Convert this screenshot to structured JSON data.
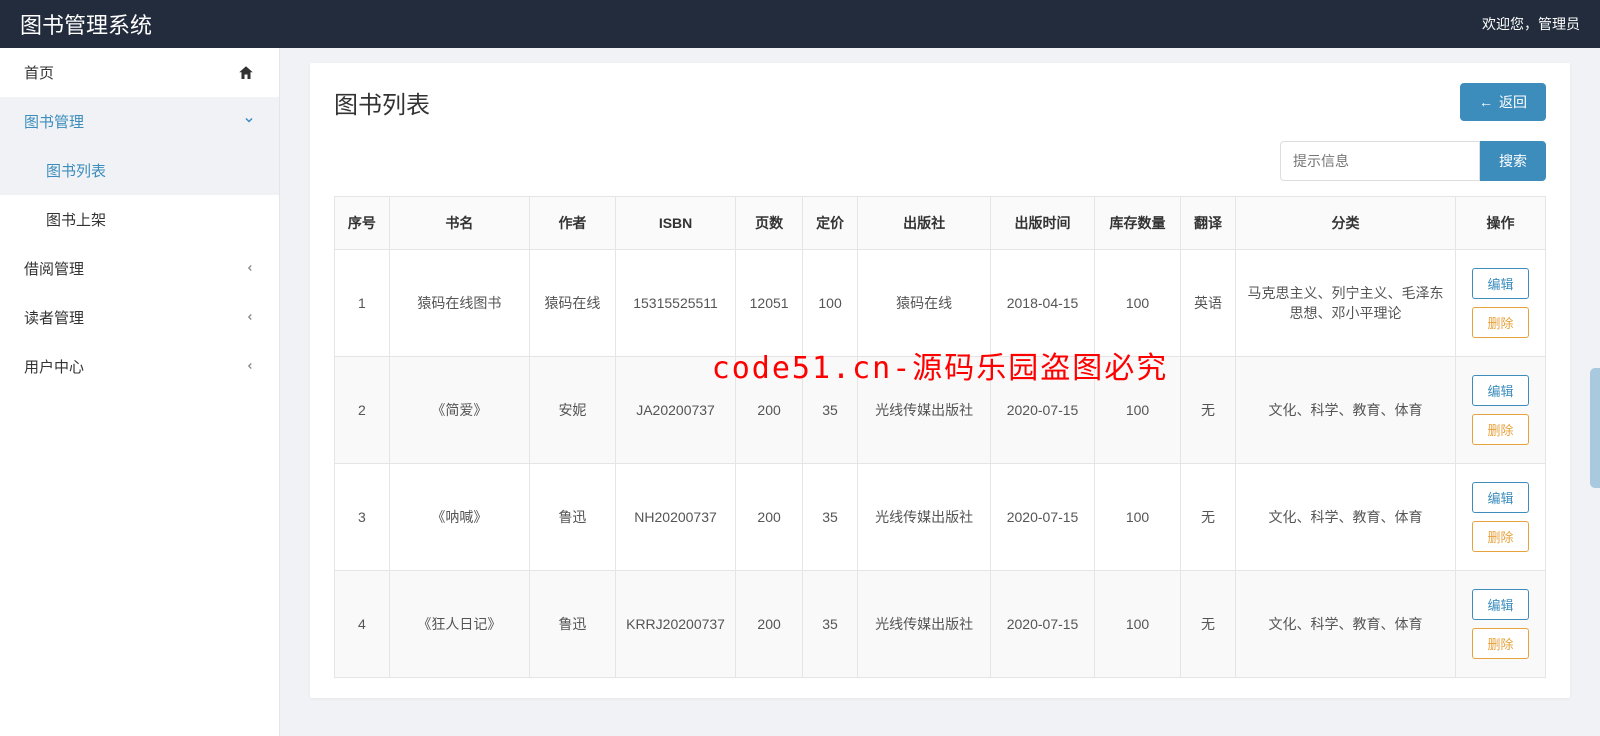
{
  "navbar": {
    "brand": "图书管理系统",
    "welcome": "欢迎您，管理员"
  },
  "sidebar": {
    "home": "首页",
    "book_mgmt": "图书管理",
    "book_list": "图书列表",
    "book_add": "图书上架",
    "borrow_mgmt": "借阅管理",
    "reader_mgmt": "读者管理",
    "user_center": "用户中心"
  },
  "page": {
    "title": "图书列表",
    "back_label": "返回",
    "search_placeholder": "提示信息",
    "search_btn": "搜索"
  },
  "table": {
    "headers": [
      "序号",
      "书名",
      "作者",
      "ISBN",
      "页数",
      "定价",
      "出版社",
      "出版时间",
      "库存数量",
      "翻译",
      "分类",
      "操作"
    ],
    "edit_label": "编辑",
    "delete_label": "删除",
    "rows": [
      {
        "idx": "1",
        "title": "猿码在线图书",
        "author": "猿码在线",
        "isbn": "15315525511",
        "pages": "12051",
        "price": "100",
        "publisher": "猿码在线",
        "pubdate": "2018-04-15",
        "stock": "100",
        "translate": "英语",
        "category": "马克思主义、列宁主义、毛泽东思想、邓小平理论"
      },
      {
        "idx": "2",
        "title": "《简爱》",
        "author": "安妮",
        "isbn": "JA20200737",
        "pages": "200",
        "price": "35",
        "publisher": "光线传媒出版社",
        "pubdate": "2020-07-15",
        "stock": "100",
        "translate": "无",
        "category": "文化、科学、教育、体育"
      },
      {
        "idx": "3",
        "title": "《呐喊》",
        "author": "鲁迅",
        "isbn": "NH20200737",
        "pages": "200",
        "price": "35",
        "publisher": "光线传媒出版社",
        "pubdate": "2020-07-15",
        "stock": "100",
        "translate": "无",
        "category": "文化、科学、教育、体育"
      },
      {
        "idx": "4",
        "title": "《狂人日记》",
        "author": "鲁迅",
        "isbn": "KRRJ20200737",
        "pages": "200",
        "price": "35",
        "publisher": "光线传媒出版社",
        "pubdate": "2020-07-15",
        "stock": "100",
        "translate": "无",
        "category": "文化、科学、教育、体育"
      }
    ]
  },
  "watermark": "code51.cn-源码乐园盗图必究"
}
